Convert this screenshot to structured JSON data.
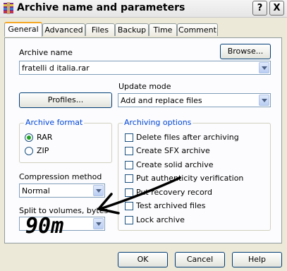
{
  "window": {
    "title": "Archive name and parameters",
    "help_label": "?",
    "close_label": "X"
  },
  "tabs": [
    {
      "label": "General"
    },
    {
      "label": "Advanced"
    },
    {
      "label": "Files"
    },
    {
      "label": "Backup"
    },
    {
      "label": "Time"
    },
    {
      "label": "Comment"
    }
  ],
  "archive_name": {
    "label": "Archive name",
    "value": "fratelli d italia.rar",
    "browse_label": "Browse..."
  },
  "profiles_label": "Profiles...",
  "update_mode": {
    "label": "Update mode",
    "value": "Add and replace files"
  },
  "archive_format": {
    "title": "Archive format",
    "options": [
      "RAR",
      "ZIP"
    ],
    "selected": "RAR"
  },
  "compression": {
    "label": "Compression method",
    "value": "Normal"
  },
  "split": {
    "label": "Split to volumes, bytes",
    "handwritten": "90m"
  },
  "archiving_options": {
    "title": "Archiving options",
    "items": [
      {
        "label": "Delete files after archiving",
        "checked": false
      },
      {
        "label": "Create SFX archive",
        "checked": false
      },
      {
        "label": "Create solid archive",
        "checked": false
      },
      {
        "label": "Put authenticity verification",
        "checked": false
      },
      {
        "label": "Put recovery record",
        "checked": false
      },
      {
        "label": "Test archived files",
        "checked": false
      },
      {
        "label": "Lock archive",
        "checked": false
      }
    ]
  },
  "buttons": {
    "ok": "OK",
    "cancel": "Cancel",
    "help": "Help"
  },
  "colors": {
    "group_title": "#0046d5",
    "active_tab_accent": "#f5a623",
    "dialog_bg": "#ece9d8"
  }
}
